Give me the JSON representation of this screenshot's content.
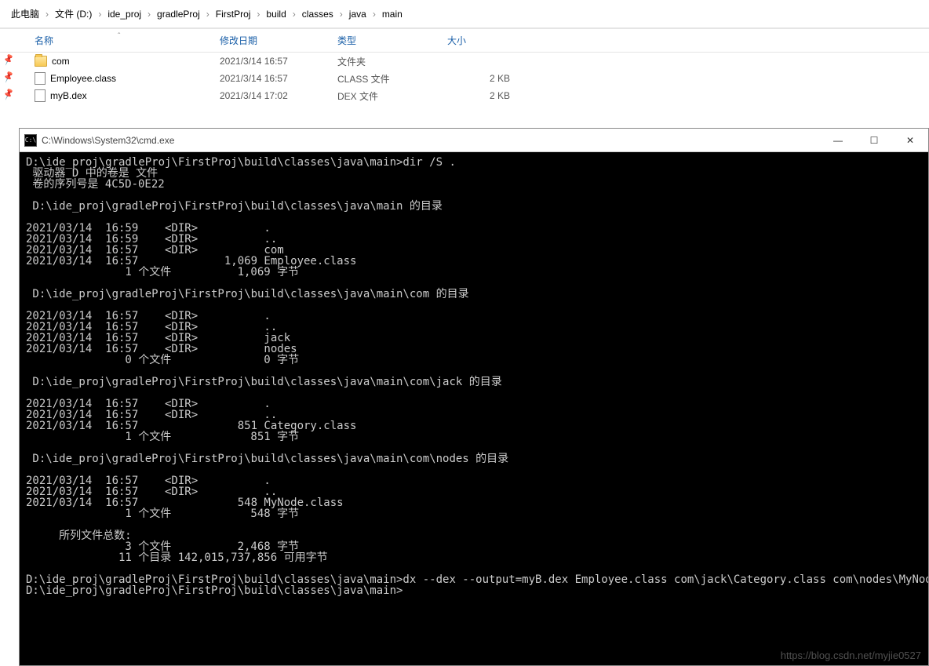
{
  "breadcrumb": {
    "items": [
      "此电脑",
      "文件 (D:)",
      "ide_proj",
      "gradleProj",
      "FirstProj",
      "build",
      "classes",
      "java",
      "main"
    ]
  },
  "columns": {
    "name": "名称",
    "date": "修改日期",
    "type": "类型",
    "size": "大小"
  },
  "files": [
    {
      "name": "com",
      "date": "2021/3/14 16:57",
      "type": "文件夹",
      "size": "",
      "icon": "folder"
    },
    {
      "name": "Employee.class",
      "date": "2021/3/14 16:57",
      "type": "CLASS 文件",
      "size": "2 KB",
      "icon": "file"
    },
    {
      "name": "myB.dex",
      "date": "2021/3/14 17:02",
      "type": "DEX 文件",
      "size": "2 KB",
      "icon": "file"
    }
  ],
  "cmd": {
    "title": "C:\\Windows\\System32\\cmd.exe",
    "icon_text": "C:\\",
    "output": "D:\\ide_proj\\gradleProj\\FirstProj\\build\\classes\\java\\main>dir /S .\n 驱动器 D 中的卷是 文件\n 卷的序列号是 4C5D-0E22\n\n D:\\ide_proj\\gradleProj\\FirstProj\\build\\classes\\java\\main 的目录\n\n2021/03/14  16:59    <DIR>          .\n2021/03/14  16:59    <DIR>          ..\n2021/03/14  16:57    <DIR>          com\n2021/03/14  16:57             1,069 Employee.class\n               1 个文件          1,069 字节\n\n D:\\ide_proj\\gradleProj\\FirstProj\\build\\classes\\java\\main\\com 的目录\n\n2021/03/14  16:57    <DIR>          .\n2021/03/14  16:57    <DIR>          ..\n2021/03/14  16:57    <DIR>          jack\n2021/03/14  16:57    <DIR>          nodes\n               0 个文件              0 字节\n\n D:\\ide_proj\\gradleProj\\FirstProj\\build\\classes\\java\\main\\com\\jack 的目录\n\n2021/03/14  16:57    <DIR>          .\n2021/03/14  16:57    <DIR>          ..\n2021/03/14  16:57               851 Category.class\n               1 个文件            851 字节\n\n D:\\ide_proj\\gradleProj\\FirstProj\\build\\classes\\java\\main\\com\\nodes 的目录\n\n2021/03/14  16:57    <DIR>          .\n2021/03/14  16:57    <DIR>          ..\n2021/03/14  16:57               548 MyNode.class\n               1 个文件            548 字节\n\n     所列文件总数:\n               3 个文件          2,468 字节\n              11 个目录 142,015,737,856 可用字节\n\nD:\\ide_proj\\gradleProj\\FirstProj\\build\\classes\\java\\main>dx --dex --output=myB.dex Employee.class com\\jack\\Category.class com\\nodes\\MyNode.class\nD:\\ide_proj\\gradleProj\\FirstProj\\build\\classes\\java\\main>"
  },
  "watermark": "https://blog.csdn.net/myjie0527",
  "win_controls": {
    "minimize": "—",
    "maximize": "☐",
    "close": "✕"
  }
}
